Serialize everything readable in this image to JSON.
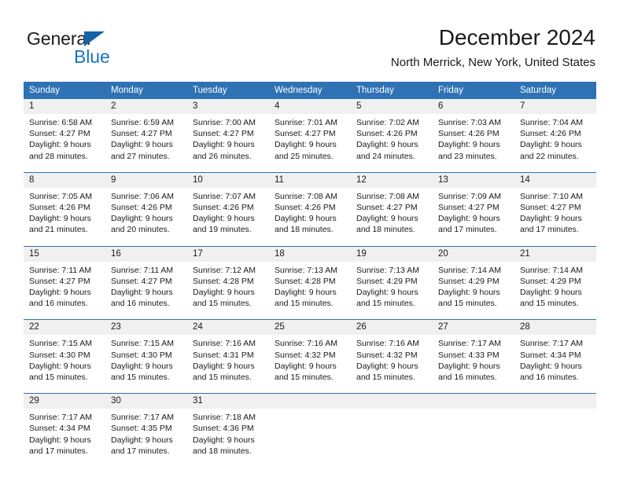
{
  "brand": {
    "name_top": "General",
    "name_bottom": "Blue",
    "triangle_color": "#1464a5",
    "blue_text_color": "#1476c4"
  },
  "header": {
    "title": "December 2024",
    "subtitle": "North Merrick, New York, United States"
  },
  "theme": {
    "header_blue": "#2E72B4",
    "daynum_gray": "#F0F0F0",
    "text": "#1a1a1a"
  },
  "weekday_headers": [
    "Sunday",
    "Monday",
    "Tuesday",
    "Wednesday",
    "Thursday",
    "Friday",
    "Saturday"
  ],
  "weeks": [
    [
      {
        "day": "1",
        "lines": [
          "Sunrise: 6:58 AM",
          "Sunset: 4:27 PM",
          "Daylight: 9 hours",
          "and 28 minutes."
        ]
      },
      {
        "day": "2",
        "lines": [
          "Sunrise: 6:59 AM",
          "Sunset: 4:27 PM",
          "Daylight: 9 hours",
          "and 27 minutes."
        ]
      },
      {
        "day": "3",
        "lines": [
          "Sunrise: 7:00 AM",
          "Sunset: 4:27 PM",
          "Daylight: 9 hours",
          "and 26 minutes."
        ]
      },
      {
        "day": "4",
        "lines": [
          "Sunrise: 7:01 AM",
          "Sunset: 4:27 PM",
          "Daylight: 9 hours",
          "and 25 minutes."
        ]
      },
      {
        "day": "5",
        "lines": [
          "Sunrise: 7:02 AM",
          "Sunset: 4:26 PM",
          "Daylight: 9 hours",
          "and 24 minutes."
        ]
      },
      {
        "day": "6",
        "lines": [
          "Sunrise: 7:03 AM",
          "Sunset: 4:26 PM",
          "Daylight: 9 hours",
          "and 23 minutes."
        ]
      },
      {
        "day": "7",
        "lines": [
          "Sunrise: 7:04 AM",
          "Sunset: 4:26 PM",
          "Daylight: 9 hours",
          "and 22 minutes."
        ]
      }
    ],
    [
      {
        "day": "8",
        "lines": [
          "Sunrise: 7:05 AM",
          "Sunset: 4:26 PM",
          "Daylight: 9 hours",
          "and 21 minutes."
        ]
      },
      {
        "day": "9",
        "lines": [
          "Sunrise: 7:06 AM",
          "Sunset: 4:26 PM",
          "Daylight: 9 hours",
          "and 20 minutes."
        ]
      },
      {
        "day": "10",
        "lines": [
          "Sunrise: 7:07 AM",
          "Sunset: 4:26 PM",
          "Daylight: 9 hours",
          "and 19 minutes."
        ]
      },
      {
        "day": "11",
        "lines": [
          "Sunrise: 7:08 AM",
          "Sunset: 4:26 PM",
          "Daylight: 9 hours",
          "and 18 minutes."
        ]
      },
      {
        "day": "12",
        "lines": [
          "Sunrise: 7:08 AM",
          "Sunset: 4:27 PM",
          "Daylight: 9 hours",
          "and 18 minutes."
        ]
      },
      {
        "day": "13",
        "lines": [
          "Sunrise: 7:09 AM",
          "Sunset: 4:27 PM",
          "Daylight: 9 hours",
          "and 17 minutes."
        ]
      },
      {
        "day": "14",
        "lines": [
          "Sunrise: 7:10 AM",
          "Sunset: 4:27 PM",
          "Daylight: 9 hours",
          "and 17 minutes."
        ]
      }
    ],
    [
      {
        "day": "15",
        "lines": [
          "Sunrise: 7:11 AM",
          "Sunset: 4:27 PM",
          "Daylight: 9 hours",
          "and 16 minutes."
        ]
      },
      {
        "day": "16",
        "lines": [
          "Sunrise: 7:11 AM",
          "Sunset: 4:27 PM",
          "Daylight: 9 hours",
          "and 16 minutes."
        ]
      },
      {
        "day": "17",
        "lines": [
          "Sunrise: 7:12 AM",
          "Sunset: 4:28 PM",
          "Daylight: 9 hours",
          "and 15 minutes."
        ]
      },
      {
        "day": "18",
        "lines": [
          "Sunrise: 7:13 AM",
          "Sunset: 4:28 PM",
          "Daylight: 9 hours",
          "and 15 minutes."
        ]
      },
      {
        "day": "19",
        "lines": [
          "Sunrise: 7:13 AM",
          "Sunset: 4:29 PM",
          "Daylight: 9 hours",
          "and 15 minutes."
        ]
      },
      {
        "day": "20",
        "lines": [
          "Sunrise: 7:14 AM",
          "Sunset: 4:29 PM",
          "Daylight: 9 hours",
          "and 15 minutes."
        ]
      },
      {
        "day": "21",
        "lines": [
          "Sunrise: 7:14 AM",
          "Sunset: 4:29 PM",
          "Daylight: 9 hours",
          "and 15 minutes."
        ]
      }
    ],
    [
      {
        "day": "22",
        "lines": [
          "Sunrise: 7:15 AM",
          "Sunset: 4:30 PM",
          "Daylight: 9 hours",
          "and 15 minutes."
        ]
      },
      {
        "day": "23",
        "lines": [
          "Sunrise: 7:15 AM",
          "Sunset: 4:30 PM",
          "Daylight: 9 hours",
          "and 15 minutes."
        ]
      },
      {
        "day": "24",
        "lines": [
          "Sunrise: 7:16 AM",
          "Sunset: 4:31 PM",
          "Daylight: 9 hours",
          "and 15 minutes."
        ]
      },
      {
        "day": "25",
        "lines": [
          "Sunrise: 7:16 AM",
          "Sunset: 4:32 PM",
          "Daylight: 9 hours",
          "and 15 minutes."
        ]
      },
      {
        "day": "26",
        "lines": [
          "Sunrise: 7:16 AM",
          "Sunset: 4:32 PM",
          "Daylight: 9 hours",
          "and 15 minutes."
        ]
      },
      {
        "day": "27",
        "lines": [
          "Sunrise: 7:17 AM",
          "Sunset: 4:33 PM",
          "Daylight: 9 hours",
          "and 16 minutes."
        ]
      },
      {
        "day": "28",
        "lines": [
          "Sunrise: 7:17 AM",
          "Sunset: 4:34 PM",
          "Daylight: 9 hours",
          "and 16 minutes."
        ]
      }
    ],
    [
      {
        "day": "29",
        "lines": [
          "Sunrise: 7:17 AM",
          "Sunset: 4:34 PM",
          "Daylight: 9 hours",
          "and 17 minutes."
        ]
      },
      {
        "day": "30",
        "lines": [
          "Sunrise: 7:17 AM",
          "Sunset: 4:35 PM",
          "Daylight: 9 hours",
          "and 17 minutes."
        ]
      },
      {
        "day": "31",
        "lines": [
          "Sunrise: 7:18 AM",
          "Sunset: 4:36 PM",
          "Daylight: 9 hours",
          "and 18 minutes."
        ]
      },
      {
        "day": "",
        "lines": []
      },
      {
        "day": "",
        "lines": []
      },
      {
        "day": "",
        "lines": []
      },
      {
        "day": "",
        "lines": []
      }
    ]
  ]
}
